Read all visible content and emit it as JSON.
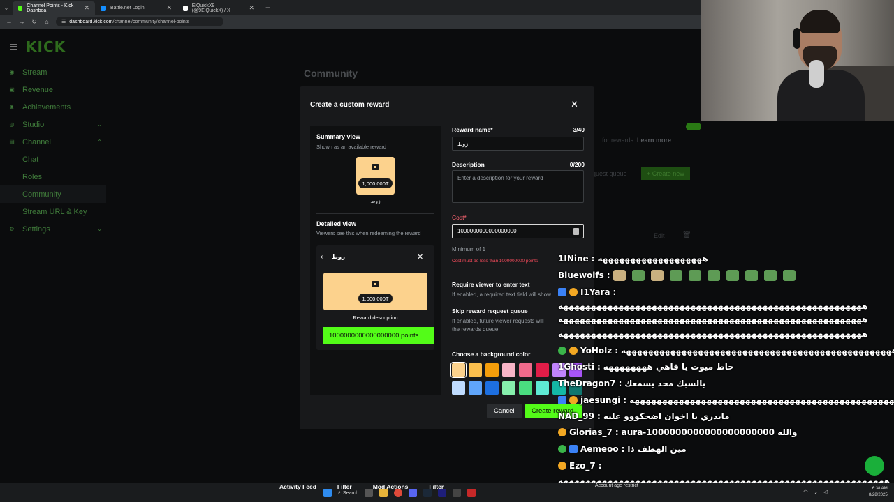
{
  "browser": {
    "tabs": [
      {
        "label": "Channel Points - Kick Dashboa",
        "color": "#53fc18",
        "active": true
      },
      {
        "label": "Battle.net Login",
        "color": "#148eff",
        "active": false
      },
      {
        "label": "ElQuickX9 (@9ElQuickX) / X",
        "color": "#ffffff",
        "active": false
      }
    ],
    "new_tab": "+",
    "url_domain": "dashboard.kick.com",
    "url_path": "/channel/community/channel-points"
  },
  "dashboard": {
    "logo": "KICK",
    "page_title": "Community",
    "sidebar": [
      {
        "label": "Stream",
        "icon": "radio-icon",
        "glyph": "◉"
      },
      {
        "label": "Revenue",
        "icon": "wallet-icon",
        "glyph": "▣"
      },
      {
        "label": "Achievements",
        "icon": "trophy-icon",
        "glyph": "♜"
      },
      {
        "label": "Studio",
        "icon": "studio-icon",
        "glyph": "◎",
        "chevron": "⌄"
      },
      {
        "label": "Channel",
        "icon": "channel-icon",
        "glyph": "▤",
        "chevron": "⌃"
      },
      {
        "label": "Settings",
        "icon": "gear-icon",
        "glyph": "⚙",
        "chevron": "⌄"
      }
    ],
    "channel_subitems": [
      "Chat",
      "Roles",
      "Community",
      "Stream URL & Key"
    ],
    "bg_rewards_text": "for rewards.",
    "bg_learn_more": "Learn more",
    "bg_queue": "quest queue",
    "bg_create_new": "Create new",
    "bg_edit": "Edit"
  },
  "modal": {
    "title": "Create a custom reward",
    "summary_title": "Summary view",
    "summary_sub": "Shown as an available reward",
    "card_cost": "1,000,000T",
    "card_name": "زوط",
    "detailed_title": "Detailed view",
    "detailed_sub": "Viewers see this when redeeming the reward",
    "detail_name": "زوط",
    "detail_cost": "1,000,000T",
    "reward_description": "Reward description",
    "redeem_label": "1000000000000000000 points",
    "form": {
      "name_label": "Reward name*",
      "name_count": "3/40",
      "name_value": "زوط",
      "desc_label": "Description",
      "desc_count": "0/200",
      "desc_placeholder": "Enter a description for your reward",
      "cost_label": "Cost*",
      "cost_value": "1000000000000000000",
      "cost_min": "Minimum of 1",
      "cost_error": "Cost must be less than 1000000000 points",
      "require_title": "Require viewer to enter text",
      "require_sub": "If enabled, a required text field will show",
      "skip_title": "Skip reward request queue",
      "skip_sub_1": "If enabled, future viewer requests will",
      "skip_sub_2": "the rewards queue",
      "color_title": "Choose a background color",
      "swatches_row1": [
        "#fcd28d",
        "#fbbf4d",
        "#f59e0b",
        "#f9b4c7",
        "#f06a8b",
        "#e11d48",
        "#c084fc",
        "#a855f7"
      ],
      "swatches_row2": [
        "#bfdbfe",
        "#60a5fa",
        "#1d6fe0",
        "#86efac",
        "#4ade80",
        "#5eead4",
        "#14b8a6",
        "#0f766e"
      ]
    },
    "cancel_label": "Cancel",
    "create_label": "Create reward"
  },
  "chat": [
    {
      "user": "1INine",
      "msg": "هههههههههههههههههههه",
      "badges": []
    },
    {
      "user": "Bluewolfs",
      "msg": "",
      "badges": [],
      "emotes": 10
    },
    {
      "user": "I1Yara",
      "msg": "",
      "badges": [
        "blue",
        "gold"
      ]
    },
    {
      "user": "",
      "msg": "هههههههههههههههههههههههههههههههههههههههههههههههههههههههه",
      "badges": []
    },
    {
      "user": "",
      "msg": "هههههههههههههههههههههههههههههههههههههههههههههههههههههههه",
      "badges": []
    },
    {
      "user": "",
      "msg": "هههههههههههههههههههههههههههههههههههههههههههههههههههههههه",
      "badges": []
    },
    {
      "user": "YoHolz",
      "msg": "هههههههههههههههههههههههههههههههههههههههههههههههههه",
      "badges": [
        "check",
        "gold"
      ]
    },
    {
      "user": "1Ghosti",
      "msg": "حاط ميوت يا فاهي ههههههههه",
      "badges": []
    },
    {
      "user": "TheDragon7",
      "msg": "يالسبك محد يسمعك",
      "badges": []
    },
    {
      "user": "jaesungi",
      "msg": "ههههههههههههههههههههههههههههههههههههههههههههههههه",
      "badges": [
        "blue",
        "gold"
      ]
    },
    {
      "user": "NAD_99",
      "msg": "مايدري يا اخوان اضحكووو عليه",
      "badges": []
    },
    {
      "user": "Glorias_7",
      "msg": "aura-1000000000000000000000 والله",
      "badges": [
        "gold"
      ]
    },
    {
      "user": "Aemeoo",
      "msg": "مين الهطف ذا",
      "badges": [
        "check",
        "blue"
      ]
    },
    {
      "user": "Ezo_7",
      "msg": "",
      "badges": [
        "gold"
      ]
    },
    {
      "user": "",
      "msg": "هههههههههههههههههههههههههههههههههههههههههههههههههههههههههههه",
      "badges": []
    }
  ],
  "taskbar": {
    "activity_feed": "Activity Feed",
    "filter_1": "Filter",
    "mod_actions": "Mod Actions",
    "filter_2": "Filter",
    "search": "Search",
    "account_age": "Account age restrict",
    "time": "6:38 AM",
    "date": "8/28/2025"
  }
}
